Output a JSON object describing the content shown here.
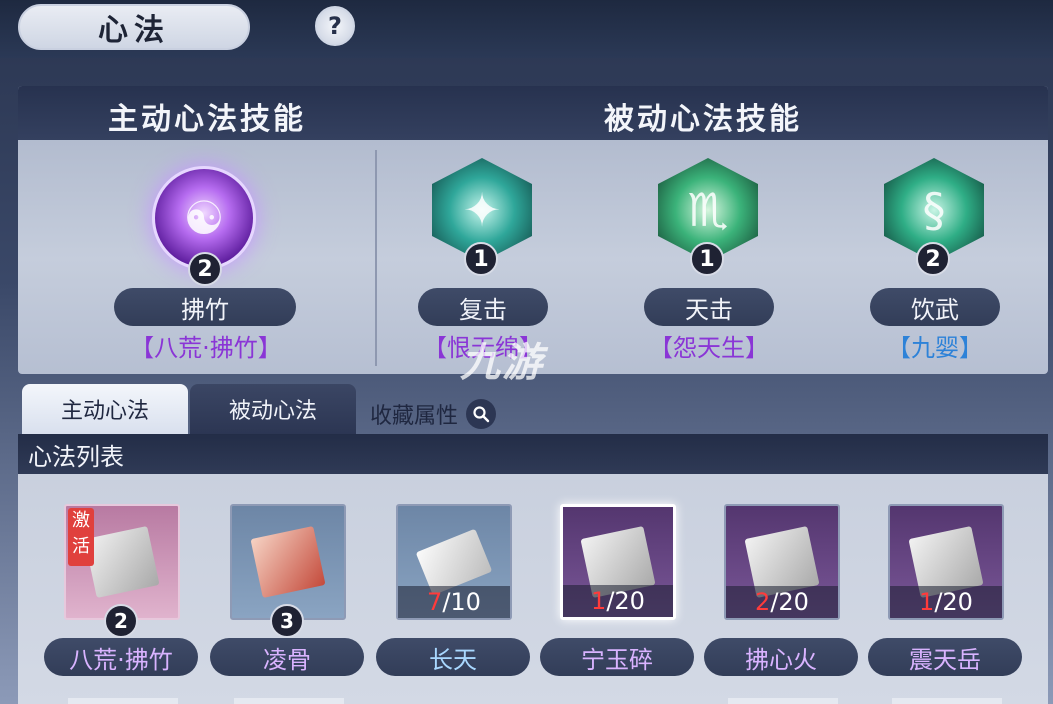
{
  "header": {
    "title": "心法",
    "help_label": "?"
  },
  "skills_panel": {
    "active_heading": "主动心法技能",
    "passive_heading": "被动心法技能",
    "active_skill": {
      "name": "拂竹",
      "level": "2",
      "source": "【八荒·拂竹】",
      "icon": "meditating-figure-icon"
    },
    "passive_skills": [
      {
        "name": "复击",
        "level": "1",
        "source": "【恨无绵】",
        "icon": "spinning-blade-icon"
      },
      {
        "name": "天击",
        "level": "1",
        "source": "【怨天生】",
        "icon": "scorpion-icon"
      },
      {
        "name": "饮武",
        "level": "2",
        "source": "【九婴】",
        "icon": "serpent-icon"
      }
    ]
  },
  "watermark": "九游",
  "tabs": {
    "active": "主动心法",
    "passive": "被动心法",
    "favorites": "收藏属性"
  },
  "list": {
    "heading": "心法列表",
    "items": [
      {
        "name": "八荒·拂竹",
        "badge": "2",
        "tag": "激活",
        "progress_current": "",
        "progress_total": ""
      },
      {
        "name": "凌骨",
        "badge": "3",
        "tag": "",
        "progress_current": "",
        "progress_total": ""
      },
      {
        "name": "长天",
        "badge": "",
        "tag": "",
        "progress_current": "7",
        "progress_total": "/10"
      },
      {
        "name": "宁玉碎",
        "badge": "",
        "tag": "",
        "progress_current": "1",
        "progress_total": "/20"
      },
      {
        "name": "拂心火",
        "badge": "",
        "tag": "",
        "progress_current": "2",
        "progress_total": "/20"
      },
      {
        "name": "震天岳",
        "badge": "",
        "tag": "",
        "progress_current": "1",
        "progress_total": "/20"
      }
    ]
  },
  "colors": {
    "active_accent": "#8a35d6",
    "passive_accent": "#2d82d8",
    "progress_current": "#ff3b3b"
  }
}
